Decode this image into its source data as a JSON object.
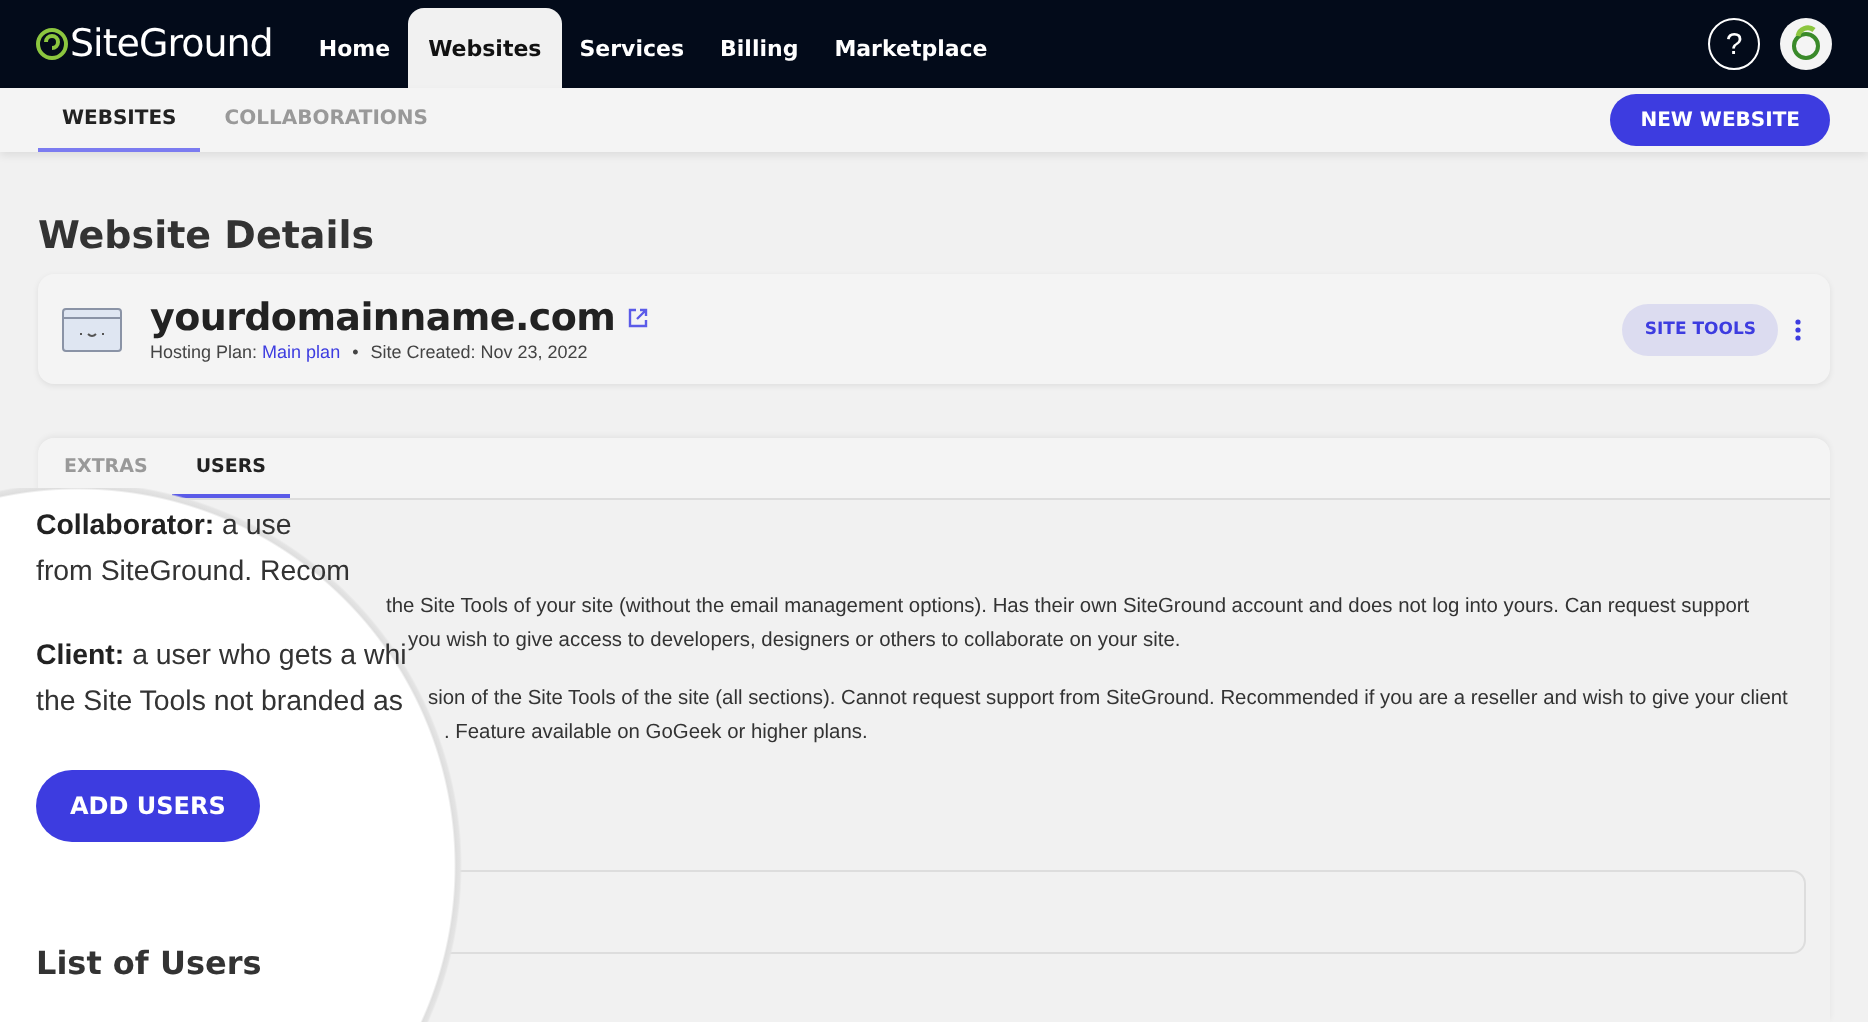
{
  "header": {
    "logo": "SiteGround",
    "nav": [
      {
        "label": "Home",
        "selected": false
      },
      {
        "label": "Websites",
        "selected": true
      },
      {
        "label": "Services",
        "selected": false
      },
      {
        "label": "Billing",
        "selected": false
      },
      {
        "label": "Marketplace",
        "selected": false
      }
    ],
    "help": "?"
  },
  "subnav": {
    "tabs": [
      {
        "label": "WEBSITES",
        "selected": true
      },
      {
        "label": "COLLABORATIONS",
        "selected": false
      }
    ],
    "button": "NEW WEBSITE"
  },
  "page_title": "Website Details",
  "site_card": {
    "domain": "yourdomainname.com",
    "plan_label": "Hosting Plan:",
    "plan": "Main plan",
    "separator": "•",
    "created": "Site Created: Nov 23, 2022",
    "button": "SITE TOOLS"
  },
  "users_panel": {
    "tabs": [
      {
        "label": "EXTRAS",
        "selected": false
      },
      {
        "label": "USERS",
        "selected": true
      }
    ],
    "description_lines": [
      "the Site Tools of your site (without the email management options). Has their own SiteGround account and does not log into yours. Can request support",
      "you wish to give access to developers, designers or others to collaborate on your site.",
      "sion of the Site Tools of the site (all sections). Cannot request support from SiteGround. Recommended if you are a reseller and wish to give your client",
      ". Feature available on GoGeek or higher plans."
    ]
  },
  "magnifier": {
    "paragraphs": [
      [
        "**Collaborator:** a use",
        "from SiteGround. Recom"
      ],
      [
        "**Client:** a user who gets a whi",
        "the Site Tools not branded as"
      ]
    ],
    "button": "ADD USERS",
    "heading": "List of Users"
  }
}
